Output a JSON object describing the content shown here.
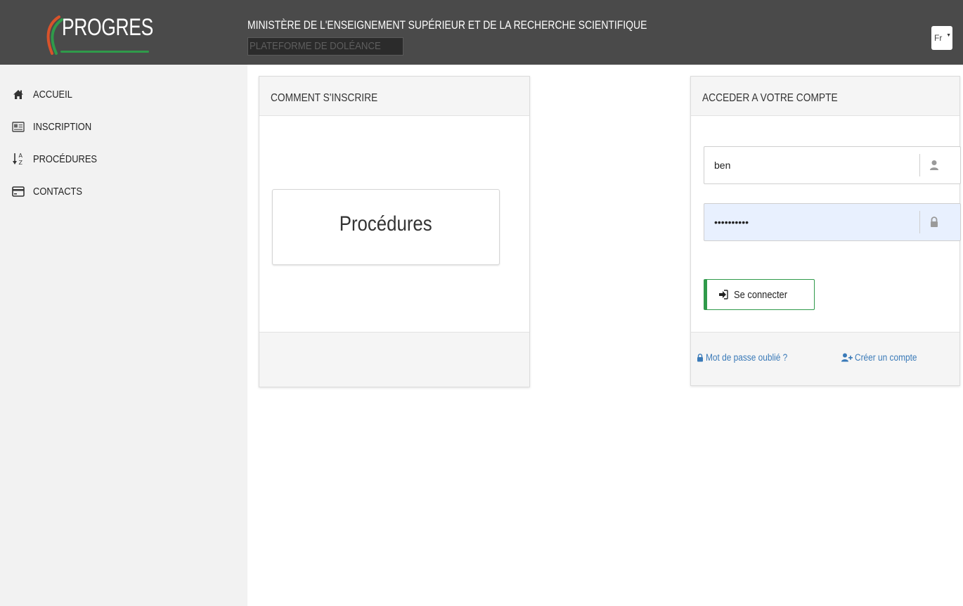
{
  "header": {
    "logo_text": "PROGRES",
    "ministry": "MINISTÈRE DE L'ENSEIGNEMENT SUPÉRIEUR ET DE LA RECHERCHE SCIENTIFIQUE",
    "platform": "PLATEFORME DE DOLÉANCE",
    "language": "Fr"
  },
  "sidebar": {
    "items": [
      {
        "label": "ACCUEIL",
        "icon": "home-icon"
      },
      {
        "label": "INSCRIPTION",
        "icon": "id-card-icon"
      },
      {
        "label": "PROCÉDURES",
        "icon": "sort-alpha-icon"
      },
      {
        "label": "CONTACTS",
        "icon": "credit-card-icon"
      }
    ]
  },
  "how_to_register": {
    "title": "COMMENT S'INSCRIRE",
    "procedures_button": "Procédures"
  },
  "login": {
    "title": "ACCEDER A VOTRE COMPTE",
    "username_value": "ben",
    "password_value": "••••••••••",
    "submit_label": "Se connecter",
    "forgot_password": "Mot de passe oublié ?",
    "create_account": "Créer un compte"
  },
  "colors": {
    "topbar": "#4a4a4a",
    "sidebar": "#f2f2f2",
    "accent_green": "#2f9a4a",
    "link_blue": "#3a7ab8",
    "autofill_blue": "#e8f0fe"
  }
}
